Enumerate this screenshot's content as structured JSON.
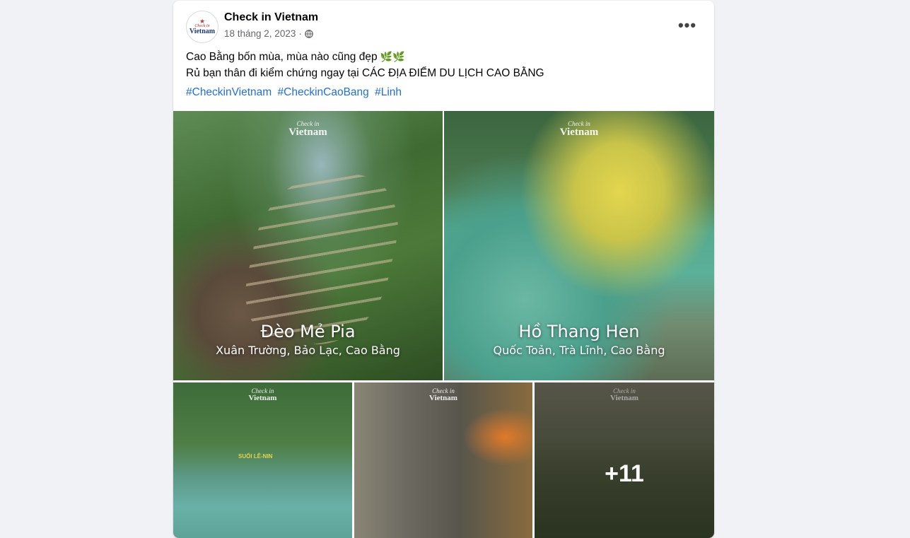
{
  "post": {
    "author": "Check in Vietnam",
    "date": "18 tháng 2, 2023",
    "separator": "·",
    "avatar_logo": {
      "top": "Check in",
      "main": "Vietnam"
    },
    "text_line1": "Cao Bằng bốn mùa, mùa nào cũng đẹp",
    "text_line1_emoji": "🌿🌿",
    "text_line2": "Rủ bạn thân đi kiểm chứng ngay tại CÁC ĐỊA ĐIỂM DU LỊCH CAO BẰNG",
    "hashtags": [
      "#CheckinVietnam",
      "#CheckinCaoBang",
      "#Linh"
    ],
    "more_icon": "three-dots-icon",
    "privacy_icon": "globe-icon"
  },
  "photos": [
    {
      "watermark_top": "Check in",
      "watermark_main": "Vietnam",
      "title": "Đèo Mẻ Pia",
      "subtitle": "Xuân Trường, Bảo Lạc, Cao Bằng"
    },
    {
      "watermark_top": "Check in",
      "watermark_main": "Vietnam",
      "title": "Hồ Thang Hen",
      "subtitle": "Quốc Toản, Trà Lĩnh, Cao Bằng"
    },
    {
      "watermark_top": "Check in",
      "watermark_main": "Vietnam",
      "sign": "SUỐI LÊ-NIN"
    },
    {
      "watermark_top": "Check in",
      "watermark_main": "Vietnam"
    },
    {
      "watermark_top": "Check in",
      "watermark_main": "Vietnam",
      "more_count": "+11"
    }
  ],
  "colors": {
    "background": "#f0f2f5",
    "hashtag": "#216fdb",
    "meta": "#65676b"
  }
}
